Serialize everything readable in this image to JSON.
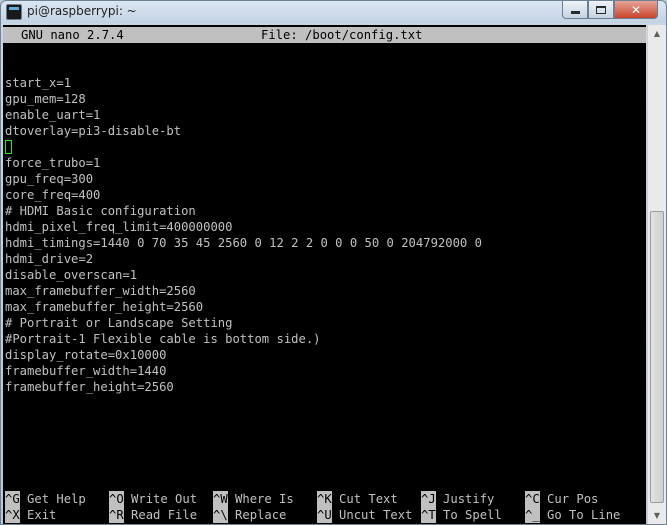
{
  "window": {
    "title": "pi@raspberrypi: ~",
    "min_symbol": "",
    "max_symbol": "",
    "close_symbol": "✕"
  },
  "nano": {
    "version": "GNU nano 2.7.4",
    "file": "File: /boot/config.txt"
  },
  "lines": [
    "",
    "start_x=1",
    "gpu_mem=128",
    "enable_uart=1",
    "dtoverlay=pi3-disable-bt",
    "",
    "force_trubo=1",
    "gpu_freq=300",
    "core_freq=400",
    "# HDMI Basic configuration",
    "hdmi_pixel_freq_limit=400000000",
    "hdmi_timings=1440 0 70 35 45 2560 0 12 2 2 0 0 0 50 0 204792000 0",
    "hdmi_drive=2",
    "disable_overscan=1",
    "max_framebuffer_width=2560",
    "max_framebuffer_height=2560",
    "# Portrait or Landscape Setting",
    "#Portrait-1 Flexible cable is bottom side.)",
    "display_rotate=0x10000",
    "framebuffer_width=1440",
    "framebuffer_height=2560"
  ],
  "shortcuts": {
    "row1": [
      {
        "key": "^G",
        "label": " Get Help"
      },
      {
        "key": "^O",
        "label": " Write Out"
      },
      {
        "key": "^W",
        "label": " Where Is"
      },
      {
        "key": "^K",
        "label": " Cut Text"
      },
      {
        "key": "^J",
        "label": " Justify"
      },
      {
        "key": "^C",
        "label": " Cur Pos"
      }
    ],
    "row2": [
      {
        "key": "^X",
        "label": " Exit"
      },
      {
        "key": "^R",
        "label": " Read File"
      },
      {
        "key": "^\\",
        "label": " Replace"
      },
      {
        "key": "^U",
        "label": " Uncut Text"
      },
      {
        "key": "^T",
        "label": " To Spell"
      },
      {
        "key": "^_",
        "label": " Go To Line"
      }
    ]
  },
  "colors": {
    "terminal_bg": "#000000",
    "terminal_fg": "#c0c0c0",
    "cursor": "#2de02d",
    "close_button": "#c7432c"
  }
}
